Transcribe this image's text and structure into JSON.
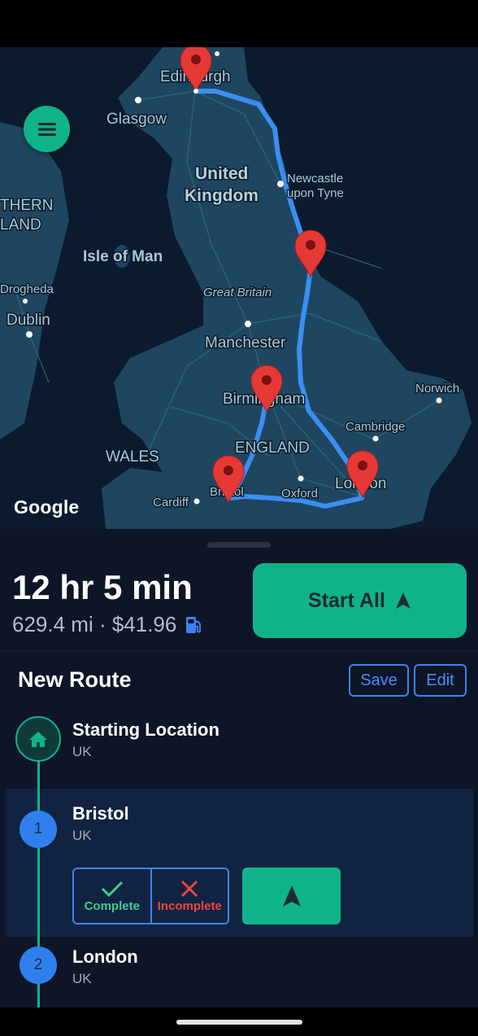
{
  "map": {
    "labels": {
      "edinburgh": "Edinburgh",
      "glasgow": "Glasgow",
      "united": "United",
      "kingdom": "Kingdom",
      "newcastle_1": "Newcastle",
      "newcastle_2": "upon Tyne",
      "thern": "THERN",
      "land": "LAND",
      "isle_of_man": "Isle of Man",
      "drogheda": "Drogheda",
      "dublin": "Dublin",
      "great_britain": "Great Britain",
      "manchester": "Manchester",
      "birmingham": "Birmingham",
      "norwich": "Norwich",
      "cambridge": "Cambridge",
      "england": "ENGLAND",
      "wales": "WALES",
      "cardiff": "Cardiff",
      "bristol": "Bristol",
      "oxford": "Oxford",
      "london": "London"
    },
    "google_logo": "Google",
    "route_color": "#3b8ef0",
    "pin_color": "#e53935"
  },
  "summary": {
    "duration": "12 hr 5 min",
    "distance_cost": "629.4 mi · $41.96"
  },
  "actions": {
    "start_all": "Start All"
  },
  "route": {
    "title": "New Route",
    "save": "Save",
    "edit": "Edit",
    "start": {
      "name": "Starting Location",
      "sub": "UK"
    },
    "stops": [
      {
        "number": "1",
        "name": "Bristol",
        "sub": "UK",
        "complete": "Complete",
        "incomplete": "Incomplete"
      },
      {
        "number": "2",
        "name": "London",
        "sub": "UK"
      }
    ]
  },
  "colors": {
    "accent": "#0fb38a",
    "blue": "#3b82f6",
    "background": "#0e1526"
  }
}
